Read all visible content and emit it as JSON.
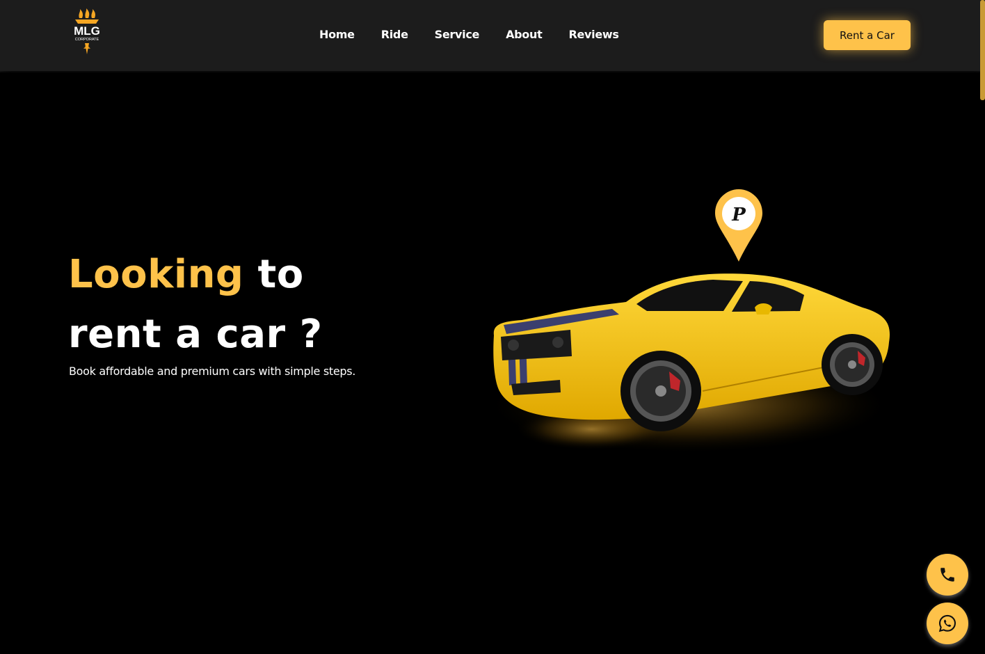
{
  "brand": {
    "logo_text": "MLG",
    "logo_subtext": "CORPORATE",
    "accent_color": "#fec24a"
  },
  "nav": {
    "items": [
      {
        "label": "Home"
      },
      {
        "label": "Ride"
      },
      {
        "label": "Service"
      },
      {
        "label": "About"
      },
      {
        "label": "Reviews"
      }
    ],
    "cta_label": "Rent a Car"
  },
  "hero": {
    "title_accent": "Looking",
    "title_rest_line1": "to",
    "title_line2": "rent a car ?",
    "subtitle": "Book affordable and premium cars with simple steps."
  },
  "graphics": {
    "pin_letter": "P",
    "car_color": "#f5c518",
    "stripe_color": "#3b3f6e"
  },
  "floating_buttons": {
    "phone_icon": "phone-icon",
    "whatsapp_icon": "whatsapp-icon"
  }
}
